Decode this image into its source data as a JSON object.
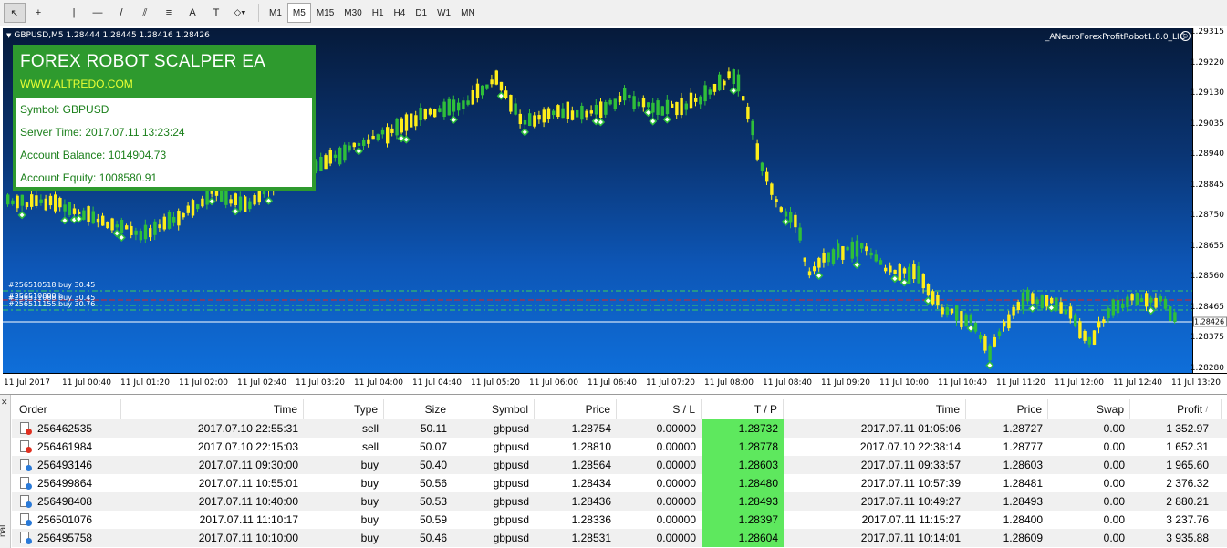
{
  "toolbar": {
    "tools": [
      {
        "name": "cursor-icon",
        "glyph": "↖"
      },
      {
        "name": "crosshair-icon",
        "glyph": "+"
      },
      {
        "name": "vertical-line-icon",
        "glyph": "|"
      },
      {
        "name": "horizontal-line-icon",
        "glyph": "—"
      },
      {
        "name": "trendline-icon",
        "glyph": "/"
      },
      {
        "name": "equidistant-channel-icon",
        "glyph": "⫽"
      },
      {
        "name": "fibonacci-icon",
        "glyph": "≡"
      },
      {
        "name": "text-icon",
        "glyph": "A"
      },
      {
        "name": "text-label-icon",
        "glyph": "T"
      },
      {
        "name": "shapes-dropdown-icon",
        "glyph": "⬦▾"
      }
    ],
    "timeframes": [
      "M1",
      "M5",
      "M15",
      "M30",
      "H1",
      "H4",
      "D1",
      "W1",
      "MN"
    ],
    "active_timeframe": "M5"
  },
  "chart": {
    "header": "GBPUSD,M5  1.28444 1.28445 1.28416 1.28426",
    "ea_name": "_ANeuroForexProfitRobot1.8.0_LIC",
    "current_price": "1.28426",
    "price_ticks": [
      "1.29315",
      "1.29220",
      "1.29130",
      "1.29035",
      "1.28940",
      "1.28845",
      "1.28750",
      "1.28655",
      "1.28560",
      "1.28465",
      "1.28375",
      "1.28280"
    ],
    "time_ticks": [
      "11 Jul 2017",
      "11 Jul 00:40",
      "11 Jul 01:20",
      "11 Jul 02:00",
      "11 Jul 02:40",
      "11 Jul 03:20",
      "11 Jul 04:00",
      "11 Jul 04:40",
      "11 Jul 05:20",
      "11 Jul 06:00",
      "11 Jul 06:40",
      "11 Jul 07:20",
      "11 Jul 08:00",
      "11 Jul 08:40",
      "11 Jul 09:20",
      "11 Jul 10:00",
      "11 Jul 10:40",
      "11 Jul 11:20",
      "11 Jul 12:00",
      "11 Jul 12:40",
      "11 Jul 13:20"
    ],
    "order_labels": [
      {
        "text": "#256510518 buy 30.45"
      },
      {
        "text": "#256510888 b"
      },
      {
        "text": "#256511088 buy 30.45"
      },
      {
        "text": "#256511155 buy 30.76"
      }
    ],
    "colors": {
      "bull": "#2fbf3a",
      "bear": "#ffee1a",
      "level_green": "#3ecf5a",
      "level_red": "#e02020",
      "level_white": "#ffffff"
    }
  },
  "ea_panel": {
    "title": "FOREX ROBOT SCALPER EA",
    "url": "WWW.ALTREDO.COM",
    "symbol": "Symbol: GBPUSD",
    "server_time": "Server Time: 2017.07.11 13:23:24",
    "balance": "Account Balance: 1014904.73",
    "equity": "Account Equity: 1008580.91"
  },
  "terminal": {
    "side_label": "nal",
    "columns": {
      "order": "Order",
      "time": "Time",
      "type": "Type",
      "size": "Size",
      "symbol": "Symbol",
      "price": "Price",
      "sl": "S / L",
      "tp": "T / P",
      "time2": "Time",
      "price2": "Price",
      "swap": "Swap",
      "profit": "Profit",
      "sort_indicator": "/"
    },
    "rows": [
      {
        "order": "256462535",
        "time": "2017.07.10 22:55:31",
        "type": "sell",
        "size": "50.11",
        "symbol": "gbpusd",
        "price": "1.28754",
        "sl": "0.00000",
        "tp": "1.28732",
        "time2": "2017.07.11 01:05:06",
        "price2": "1.28727",
        "swap": "0.00",
        "profit": "1 352.97"
      },
      {
        "order": "256461984",
        "time": "2017.07.10 22:15:03",
        "type": "sell",
        "size": "50.07",
        "symbol": "gbpusd",
        "price": "1.28810",
        "sl": "0.00000",
        "tp": "1.28778",
        "time2": "2017.07.10 22:38:14",
        "price2": "1.28777",
        "swap": "0.00",
        "profit": "1 652.31"
      },
      {
        "order": "256493146",
        "time": "2017.07.11 09:30:00",
        "type": "buy",
        "size": "50.40",
        "symbol": "gbpusd",
        "price": "1.28564",
        "sl": "0.00000",
        "tp": "1.28603",
        "time2": "2017.07.11 09:33:57",
        "price2": "1.28603",
        "swap": "0.00",
        "profit": "1 965.60"
      },
      {
        "order": "256499864",
        "time": "2017.07.11 10:55:01",
        "type": "buy",
        "size": "50.56",
        "symbol": "gbpusd",
        "price": "1.28434",
        "sl": "0.00000",
        "tp": "1.28480",
        "time2": "2017.07.11 10:57:39",
        "price2": "1.28481",
        "swap": "0.00",
        "profit": "2 376.32"
      },
      {
        "order": "256498408",
        "time": "2017.07.11 10:40:00",
        "type": "buy",
        "size": "50.53",
        "symbol": "gbpusd",
        "price": "1.28436",
        "sl": "0.00000",
        "tp": "1.28493",
        "time2": "2017.07.11 10:49:27",
        "price2": "1.28493",
        "swap": "0.00",
        "profit": "2 880.21"
      },
      {
        "order": "256501076",
        "time": "2017.07.11 11:10:17",
        "type": "buy",
        "size": "50.59",
        "symbol": "gbpusd",
        "price": "1.28336",
        "sl": "0.00000",
        "tp": "1.28397",
        "time2": "2017.07.11 11:15:27",
        "price2": "1.28400",
        "swap": "0.00",
        "profit": "3 237.76"
      },
      {
        "order": "256495758",
        "time": "2017.07.11 10:10:00",
        "type": "buy",
        "size": "50.46",
        "symbol": "gbpusd",
        "price": "1.28531",
        "sl": "0.00000",
        "tp": "1.28604",
        "time2": "2017.07.11 10:14:01",
        "price2": "1.28609",
        "swap": "0.00",
        "profit": "3 935.88"
      }
    ]
  }
}
